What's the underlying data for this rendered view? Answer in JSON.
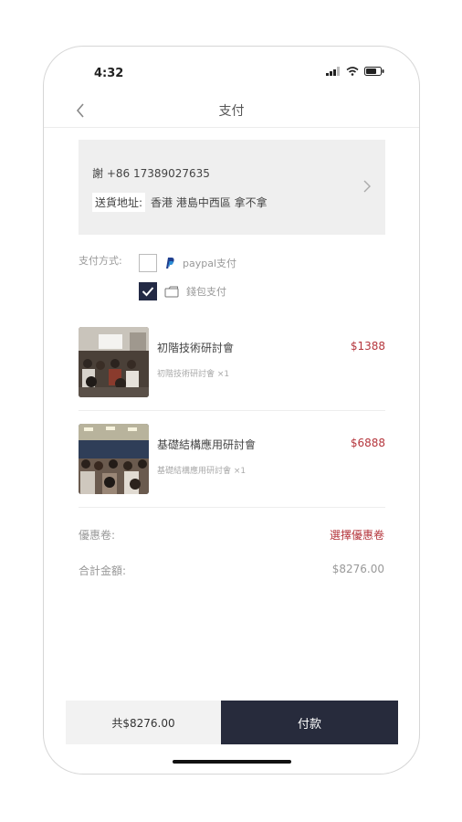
{
  "status_bar": {
    "time": "4:32"
  },
  "nav": {
    "title": "支付"
  },
  "address": {
    "name_phone": "謝 +86 17389027635",
    "label": "送貨地址:",
    "detail": "香港 港島中西區 拿不拿"
  },
  "payment": {
    "label": "支付方式:",
    "options": [
      {
        "label": "paypal支付",
        "checked": false,
        "icon": "paypal-icon"
      },
      {
        "label": "錢包支付",
        "checked": true,
        "icon": "wallet-icon"
      }
    ]
  },
  "items": [
    {
      "title": "初階技術研討會",
      "subtitle": "初階技術研討會 ×1",
      "price": "$1388"
    },
    {
      "title": "基礎結構應用研討會",
      "subtitle": "基礎結構應用研討會 ×1",
      "price": "$6888"
    }
  ],
  "coupon": {
    "label": "優惠卷:",
    "value": "選擇優惠卷"
  },
  "sum": {
    "label": "合計金額:",
    "value": "$8276.00"
  },
  "bottom_bar": {
    "total": "共$8276.00",
    "pay_label": "付款"
  },
  "colors": {
    "accent": "#b5363d",
    "dark": "#272b3c"
  }
}
